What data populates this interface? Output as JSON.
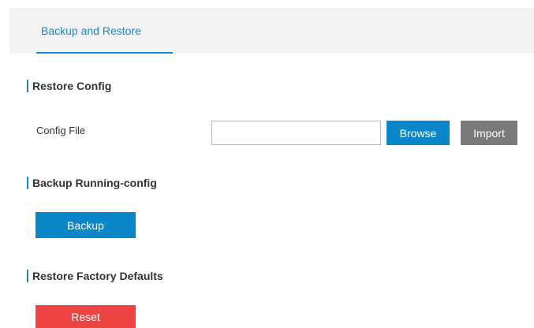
{
  "tabs": [
    {
      "label": "Backup and Restore",
      "active": true
    }
  ],
  "restore_config": {
    "title": "Restore Config",
    "config_file_label": "Config File",
    "config_file_value": "",
    "browse_label": "Browse",
    "import_label": "Import"
  },
  "backup_running": {
    "title": "Backup Running-config",
    "backup_label": "Backup"
  },
  "factory_defaults": {
    "title": "Restore Factory Defaults",
    "reset_label": "Reset"
  },
  "colors": {
    "accent": "#1a88c9",
    "primary_button": "#0b87c9",
    "import_button": "#7a7a7a",
    "danger_button": "#ee4444"
  }
}
